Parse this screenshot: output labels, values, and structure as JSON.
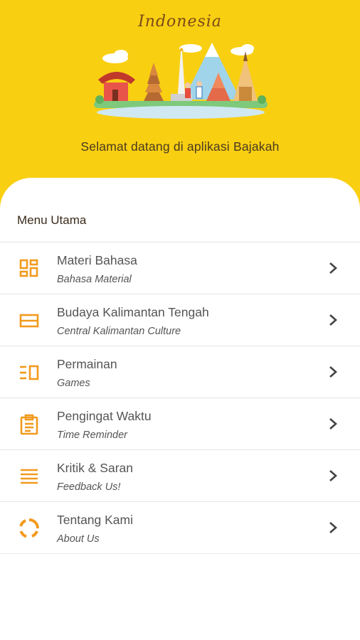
{
  "header": {
    "brand": "Indonesia",
    "welcome": "Selamat datang di aplikasi Bajakah"
  },
  "menu": {
    "title": "Menu Utama",
    "items": [
      {
        "title": "Materi Bahasa",
        "subtitle": "Bahasa Material",
        "icon": "dashboard-icon"
      },
      {
        "title": "Budaya Kalimantan Tengah",
        "subtitle": "Central Kalimantan Culture",
        "icon": "list-icon"
      },
      {
        "title": "Permainan",
        "subtitle": "Games",
        "icon": "view-list-icon"
      },
      {
        "title": "Pengingat Waktu",
        "subtitle": "Time Reminder",
        "icon": "clipboard-icon"
      },
      {
        "title": "Kritik & Saran",
        "subtitle": "Feedback Us!",
        "icon": "lines-icon"
      },
      {
        "title": "Tentang Kami",
        "subtitle": "About Us",
        "icon": "ring-icon"
      }
    ]
  },
  "colors": {
    "header_bg": "#f9cf12",
    "icon_accent": "#f29a1d",
    "text": "#555555"
  }
}
